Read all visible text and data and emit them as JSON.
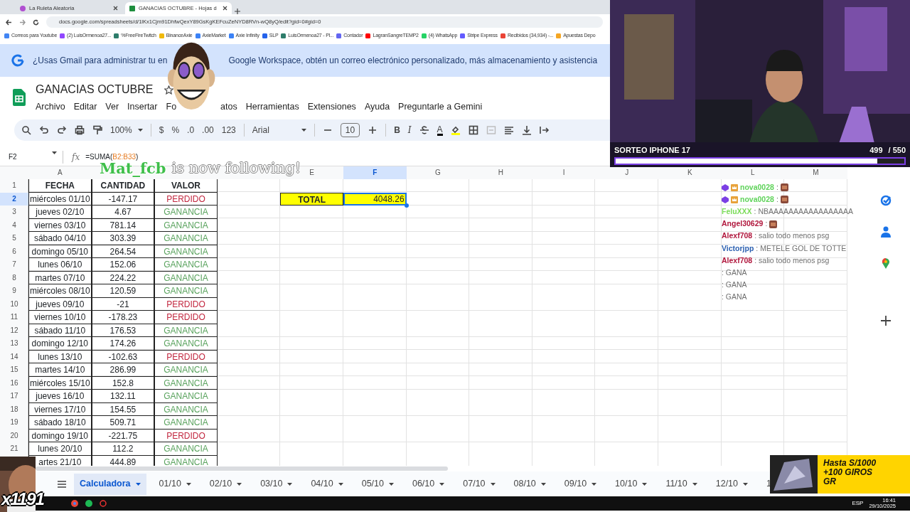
{
  "browser": {
    "tabs": [
      {
        "title": "La Ruleta Aleatoria",
        "selected": false
      },
      {
        "title": "GANACIAS OCTUBRE - Hojas d",
        "selected": true
      }
    ],
    "url": "docs.google.com/spreadsheets/d/1lKx1Cjm91DhfwQexY89GsKgKEFcuZeNYD8RVn-wQ8yQ/edit?gid=0#gid=0",
    "bookmarks": [
      {
        "label": "Correos para Youtube",
        "color": "#4285f4"
      },
      {
        "label": "(2) LuisOrmenoa27...",
        "color": "#9146ff"
      },
      {
        "label": "%FreeFireTwitch",
        "color": "#2e7d6b"
      },
      {
        "label": "BinanceAxie",
        "color": "#f0b90b"
      },
      {
        "label": "AxieMarket",
        "color": "#3b82f6"
      },
      {
        "label": "Axie Infinity",
        "color": "#3b82f6"
      },
      {
        "label": "SLP",
        "color": "#2563eb"
      },
      {
        "label": "LuisOrmenoa27 - Pl...",
        "color": "#2e7d6b"
      },
      {
        "label": "Contador",
        "color": "#6366f1"
      },
      {
        "label": "LagranSangreTEMP2",
        "color": "#ff0000"
      },
      {
        "label": "(4) WhatsApp",
        "color": "#25d366"
      },
      {
        "label": "Stripe Express",
        "color": "#635bff"
      },
      {
        "label": "Recibidos (34,934) -...",
        "color": "#ea4335"
      },
      {
        "label": "Apuestas Depo",
        "color": "#f5a623"
      }
    ]
  },
  "banner": {
    "text_before": "¿Usas Gmail para administrar tu en",
    "text_after": "Google Workspace, obtén un correo electrónico personalizado, más almacenamiento y asistencia"
  },
  "document": {
    "title": "GANACIAS OCTUBRE",
    "menu": [
      "Archivo",
      "Editar",
      "Ver",
      "Insertar",
      "Fo",
      "atos",
      "Herramientas",
      "Extensiones",
      "Ayuda",
      "Preguntarle a Gemini"
    ]
  },
  "toolbar": {
    "zoom": "100%",
    "currency": "$",
    "percent": "%",
    "decrease_decimals": ".0",
    "increase_decimals": ".00",
    "number_format": "123",
    "font": "Arial",
    "font_size": "10",
    "bold": "B",
    "italic": "I",
    "text_color": "A"
  },
  "formula_bar": {
    "cell": "F2",
    "fx_label": "fx",
    "formula_start": "=SUMA(",
    "formula_range": "B2:B33",
    "formula_end": ")"
  },
  "follow_alert": {
    "user": "Mat_fcb",
    "message": "is now following!"
  },
  "columns": [
    {
      "label": "A",
      "selected": false
    },
    {
      "covered": true
    },
    {
      "covered": true
    },
    {
      "covered": true
    },
    {
      "label": "E",
      "selected": false
    },
    {
      "label": "F",
      "selected": true
    },
    {
      "label": "G",
      "selected": false
    },
    {
      "label": "H",
      "selected": false
    },
    {
      "label": "I",
      "selected": false
    },
    {
      "label": "J",
      "selected": false
    },
    {
      "label": "K",
      "selected": false
    },
    {
      "label": "L",
      "selected": false
    },
    {
      "label": "M",
      "selected": false
    }
  ],
  "rows": [
    {
      "number": "1",
      "kind": "header",
      "selected": false,
      "cells": [
        "FECHA",
        "CANTIDAD",
        "VALOR"
      ]
    },
    {
      "number": "2",
      "kind": "loss",
      "selected": true,
      "cells": [
        "miércoles 01/10",
        "-147.17",
        "PERDIDO"
      ]
    },
    {
      "number": "3",
      "kind": "gain",
      "selected": false,
      "cells": [
        "jueves 02/10",
        "4.67",
        "GANANCIA"
      ]
    },
    {
      "number": "4",
      "kind": "gain",
      "selected": false,
      "cells": [
        "viernes 03/10",
        "781.14",
        "GANANCIA"
      ]
    },
    {
      "number": "5",
      "kind": "gain",
      "selected": false,
      "cells": [
        "sábado 04/10",
        "303.39",
        "GANANCIA"
      ]
    },
    {
      "number": "6",
      "kind": "gain",
      "selected": false,
      "cells": [
        "domingo 05/10",
        "264.54",
        "GANANCIA"
      ]
    },
    {
      "number": "7",
      "kind": "gain",
      "selected": false,
      "cells": [
        "lunes 06/10",
        "152.06",
        "GANANCIA"
      ]
    },
    {
      "number": "8",
      "kind": "gain",
      "selected": false,
      "cells": [
        "martes 07/10",
        "224.22",
        "GANANCIA"
      ]
    },
    {
      "number": "9",
      "kind": "gain",
      "selected": false,
      "cells": [
        "miércoles 08/10",
        "120.59",
        "GANANCIA"
      ]
    },
    {
      "number": "10",
      "kind": "loss",
      "selected": false,
      "cells": [
        "jueves 09/10",
        "-21",
        "PERDIDO"
      ]
    },
    {
      "number": "11",
      "kind": "loss",
      "selected": false,
      "cells": [
        "viernes 10/10",
        "-178.23",
        "PERDIDO"
      ]
    },
    {
      "number": "12",
      "kind": "gain",
      "selected": false,
      "cells": [
        "sábado 11/10",
        "176.53",
        "GANANCIA"
      ]
    },
    {
      "number": "13",
      "kind": "gain",
      "selected": false,
      "cells": [
        "domingo 12/10",
        "174.26",
        "GANANCIA"
      ]
    },
    {
      "number": "14",
      "kind": "loss",
      "selected": false,
      "cells": [
        "lunes 13/10",
        "-102.63",
        "PERDIDO"
      ]
    },
    {
      "number": "15",
      "kind": "gain",
      "selected": false,
      "cells": [
        "martes 14/10",
        "286.99",
        "GANANCIA"
      ]
    },
    {
      "number": "16",
      "kind": "gain",
      "selected": false,
      "cells": [
        "miércoles 15/10",
        "152.8",
        "GANANCIA"
      ]
    },
    {
      "number": "17",
      "kind": "gain",
      "selected": false,
      "cells": [
        "jueves 16/10",
        "132.11",
        "GANANCIA"
      ]
    },
    {
      "number": "18",
      "kind": "gain",
      "selected": false,
      "cells": [
        "viernes 17/10",
        "154.55",
        "GANANCIA"
      ]
    },
    {
      "number": "19",
      "kind": "gain",
      "selected": false,
      "cells": [
        "sábado 18/10",
        "509.71",
        "GANANCIA"
      ]
    },
    {
      "number": "20",
      "kind": "loss",
      "selected": false,
      "cells": [
        "domingo 19/10",
        "-221.75",
        "PERDIDO"
      ]
    },
    {
      "number": "21",
      "kind": "gain",
      "selected": false,
      "cells": [
        "lunes 20/10",
        "112.2",
        "GANANCIA"
      ]
    },
    {
      "kind": "gain",
      "cells": [
        "artes 21/10",
        "444.89",
        "GANANCIA"
      ]
    }
  ],
  "total": {
    "label": "TOTAL",
    "value": "4048.26",
    "selected": true
  },
  "chat": [
    {
      "user": "nova0028",
      "color": "#5fd35a",
      "badges": true,
      "message": ":",
      "emote": true
    },
    {
      "user": "nova0028",
      "color": "#5fd35a",
      "badges": true,
      "message": ":",
      "emote": true
    },
    {
      "user": "FeluXXX",
      "color": "#7cdc5a",
      "message": ": NBAAAAAAAAAAAAAAAAA"
    },
    {
      "user": "Angel30629",
      "color": "#b0163c",
      "message": ":",
      "emote": true
    },
    {
      "user": "Alexf708",
      "color": "#b0163c",
      "message": ": salio todo menos psg"
    },
    {
      "user": "Victorjpp",
      "color": "#2a5fb0",
      "message": ": METELE GOL DE TOTTE"
    },
    {
      "user": "Alexf708",
      "color": "#b0163c",
      "message": ": salio todo menos psg"
    },
    {
      "message": ": GANA"
    },
    {
      "message": ": GANA"
    },
    {
      "message": ": GANA"
    }
  ],
  "stream": {
    "goal_title": "SORTEO IPHONE 17",
    "count": "499",
    "target": "/ 550",
    "level": 0.907
  },
  "sheet_tabs": [
    {
      "label": "Calculadora",
      "selected": true
    },
    {
      "label": "01/10",
      "selected": false
    },
    {
      "label": "02/10",
      "selected": false
    },
    {
      "label": "03/10",
      "selected": false
    },
    {
      "label": "04/10",
      "selected": false
    },
    {
      "label": "05/10",
      "selected": false
    },
    {
      "label": "06/10",
      "selected": false
    },
    {
      "label": "07/10",
      "selected": false
    },
    {
      "label": "08/10",
      "selected": false
    },
    {
      "label": "09/10",
      "selected": false
    },
    {
      "label": "10/10",
      "selected": false
    },
    {
      "label": "11/10",
      "selected": false
    },
    {
      "label": "12/10",
      "selected": false
    },
    {
      "label": "1",
      "selected": false
    }
  ],
  "emote_counter": "x1191",
  "ad": {
    "lines": [
      "Hasta S/1000",
      "+100 GIROS",
      "GR"
    ]
  },
  "taskbar": {
    "language": "ESP",
    "time": "16:41",
    "date": "29/10/2025"
  }
}
